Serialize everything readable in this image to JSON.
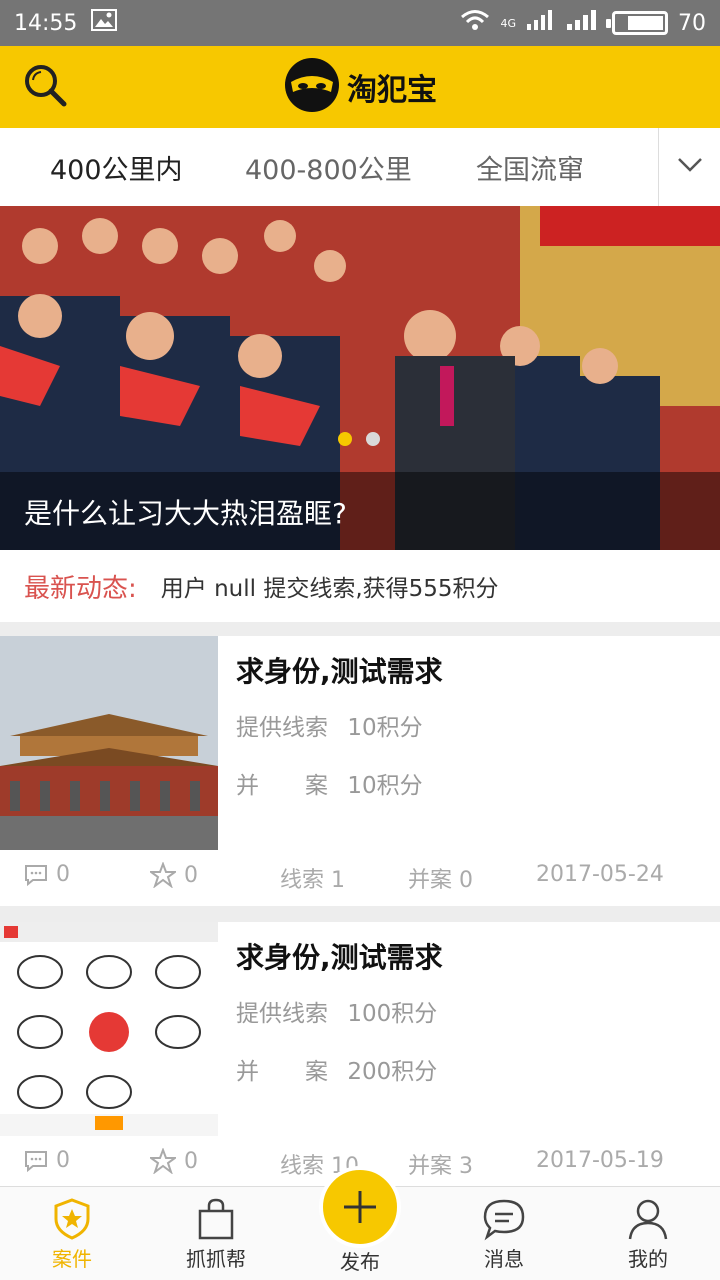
{
  "status_bar": {
    "time": "14:55",
    "network": "4G",
    "battery": "70"
  },
  "header": {
    "brand": "淘犯宝",
    "search_icon": "search-icon"
  },
  "tabs": [
    {
      "label": "400公里内",
      "active": true
    },
    {
      "label": "400-800公里",
      "active": false
    },
    {
      "label": "全国流窜",
      "active": false
    }
  ],
  "banner": {
    "caption": "是什么让习大大热泪盈眶?",
    "slide_index": 1,
    "slide_count": 2
  },
  "news": {
    "label": "最新动态:",
    "text": "用户 null 提交线索,获得555积分"
  },
  "cases": [
    {
      "title": "求身份,测试需求",
      "clue_label": "提供线索",
      "clue_value": "10积分",
      "merge_label": "并　　案",
      "merge_value": "10积分",
      "comments": "0",
      "favorites": "0",
      "clues_count": "线索 1",
      "merged_count": "并案 0",
      "date": "2017-05-24"
    },
    {
      "title": "求身份,测试需求",
      "clue_label": "提供线索",
      "clue_value": "100积分",
      "merge_label": "并　　案",
      "merge_value": "200积分",
      "comments": "0",
      "favorites": "0",
      "clues_count": "线索 10",
      "merged_count": "并案 3",
      "date": "2017-05-19"
    }
  ],
  "bottom_nav": [
    {
      "label": "案件",
      "icon": "badge-star-icon",
      "active": true
    },
    {
      "label": "抓抓帮",
      "icon": "shopping-bag-icon",
      "active": false
    },
    {
      "label": "发布",
      "icon": "plus-icon",
      "active": false
    },
    {
      "label": "消息",
      "icon": "chat-bubble-icon",
      "active": false
    },
    {
      "label": "我的",
      "icon": "user-icon",
      "active": false
    }
  ],
  "colors": {
    "brand_yellow": "#f7c800",
    "accent_red": "#d9534f",
    "status_gray": "#757575"
  }
}
